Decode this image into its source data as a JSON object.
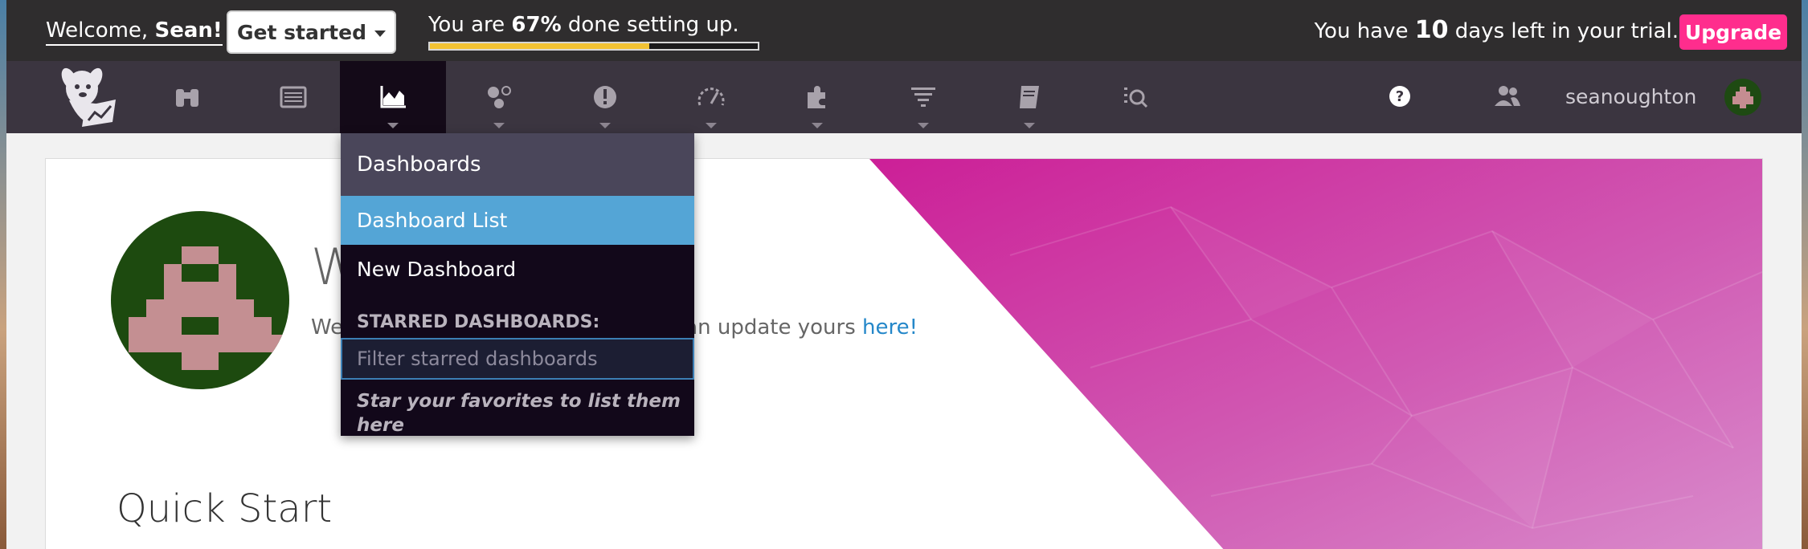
{
  "trial_bar": {
    "welcome_prefix": "Welcome, ",
    "welcome_name": "Sean!",
    "get_started_label": "Get started",
    "setup_prefix": "You are ",
    "setup_percent": "67%",
    "setup_suffix": " done setting up.",
    "setup_progress_fraction": 0.67,
    "trial_prefix": "You have ",
    "trial_days": "10",
    "trial_suffix": " days left in your trial.",
    "upgrade_label": "Upgrade",
    "upgrade_color": "#ff2d8d",
    "progress_color": "#f2c233"
  },
  "navbar": {
    "items": [
      {
        "icon": "binoculars-icon"
      },
      {
        "icon": "events-list-icon"
      },
      {
        "icon": "dashboards-chart-icon",
        "active": true
      },
      {
        "icon": "infrastructure-hexagons-icon"
      },
      {
        "icon": "monitors-alert-icon"
      },
      {
        "icon": "metrics-gauge-icon"
      },
      {
        "icon": "integrations-puzzle-icon"
      },
      {
        "icon": "logs-filter-icon"
      },
      {
        "icon": "notebooks-book-icon"
      },
      {
        "icon": "watchdog-search-icon"
      }
    ],
    "username": "seanoughton",
    "help_icon": "help-circle-icon",
    "team_icon": "team-users-icon"
  },
  "dashboards_menu": {
    "header": "Dashboards",
    "items": [
      {
        "label": "Dashboard List",
        "active": true
      },
      {
        "label": "New Dashboard",
        "active": false
      }
    ],
    "starred_label": "STARRED DASHBOARDS:",
    "filter_placeholder": "Filter starred dashboards",
    "filter_value": "",
    "empty_hint": "Star your favorites to list them here",
    "active_color": "#54a5d6"
  },
  "main": {
    "welcome_heading": "W",
    "profile_prefix": "We",
    "profile_suffix": "an update yours ",
    "profile_link": "here!",
    "quick_start_title": "Quick Start",
    "hero_color": "#d0249e"
  }
}
